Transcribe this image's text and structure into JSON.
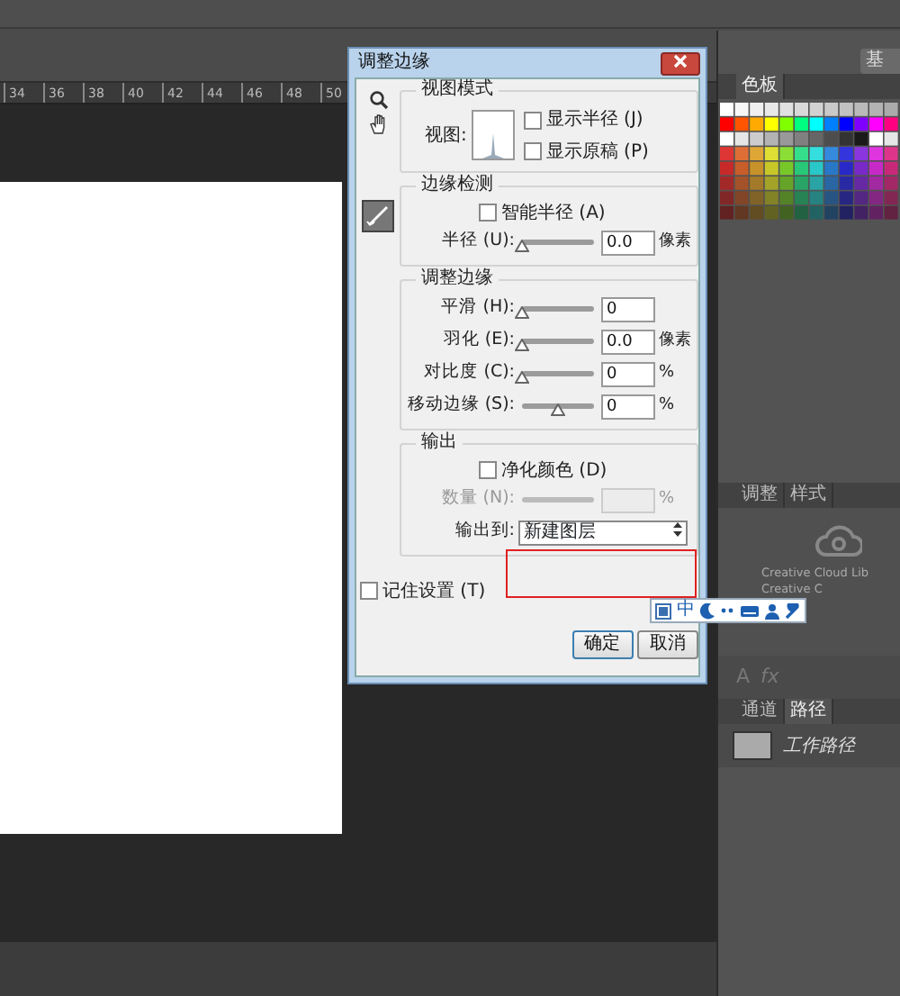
{
  "ruler": {
    "ticks": [
      "34",
      "36",
      "38",
      "40",
      "42",
      "44",
      "46",
      "48",
      "50"
    ]
  },
  "right_panel": {
    "workspace_button": "基",
    "swatch_tabs": [
      {
        "label": "色板",
        "selected": true
      }
    ],
    "adjust_tabs": [
      {
        "label": "调整",
        "selected": false
      },
      {
        "label": "样式",
        "selected": false
      }
    ],
    "library_lines": [
      "Creative Cloud Lib",
      "Creative C"
    ],
    "panel_tools": [
      "A",
      "fx"
    ],
    "path_tabs": [
      {
        "label": "通道",
        "selected": false
      },
      {
        "label": "路径",
        "selected": true
      }
    ],
    "paths": [
      {
        "label": "工作路径"
      }
    ]
  },
  "dialog": {
    "title": "调整边缘",
    "view_mode": {
      "legend": "视图模式",
      "view_label": "视图:",
      "options": [
        {
          "label": "显示半径 (J)",
          "checked": false
        },
        {
          "label": "显示原稿 (P)",
          "checked": false
        }
      ]
    },
    "edge_detection": {
      "legend": "边缘检测",
      "smart_radius": {
        "label": "智能半径 (A)",
        "checked": false
      },
      "radius": {
        "label": "半径 (U):",
        "level": 0,
        "value": "0.0",
        "unit": "像素"
      }
    },
    "adjust_edge": {
      "legend": "调整边缘",
      "sliders": [
        {
          "label": "平滑 (H):",
          "level": 0,
          "value": "0"
        },
        {
          "label": "羽化 (E):",
          "level": 0,
          "value": "0.0",
          "unit": "像素"
        },
        {
          "label": "对比度 (C):",
          "level": 0,
          "value": "0",
          "unit": "%"
        },
        {
          "label": "移动边缘 (S):",
          "level": 0.5,
          "value": "0",
          "unit": "%"
        }
      ]
    },
    "output": {
      "legend": "输出",
      "decontaminate": {
        "label": "净化颜色 (D)",
        "checked": false
      },
      "amount": {
        "label": "数量 (N):",
        "disabled": true,
        "unit": "%"
      },
      "output_to": {
        "label": "输出到:",
        "value": "新建图层"
      }
    },
    "remember": {
      "label": "记住设置 (T)",
      "checked": false
    },
    "buttons": [
      {
        "label": "确定",
        "default": true
      },
      {
        "label": "取消",
        "default": false
      }
    ]
  },
  "ime_bar": {
    "mode": "中"
  }
}
